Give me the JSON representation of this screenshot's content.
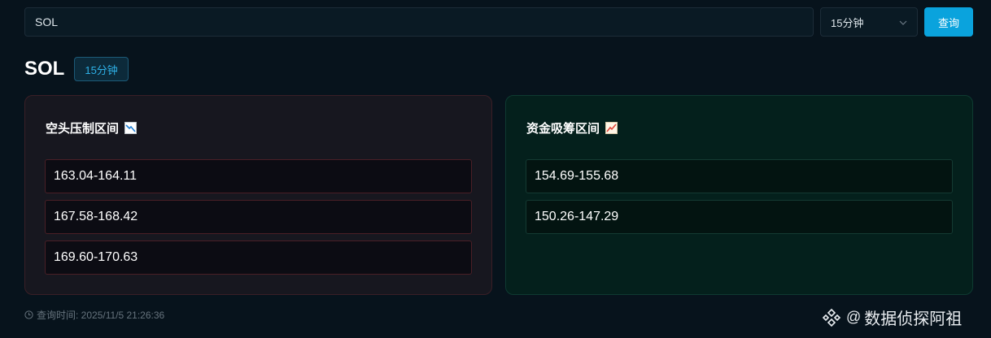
{
  "search": {
    "value": "SOL"
  },
  "interval_select": {
    "selected": "15分钟"
  },
  "query_button": {
    "label": "查询"
  },
  "title": {
    "symbol": "SOL",
    "interval_badge": "15分钟"
  },
  "bear_card": {
    "title": "空头压制区间",
    "icon": "chart-decreasing-icon",
    "zones": [
      "163.04-164.11",
      "167.58-168.42",
      "169.60-170.63"
    ]
  },
  "bull_card": {
    "title": "资金吸筹区间",
    "icon": "chart-increasing-icon",
    "zones": [
      "154.69-155.68",
      "150.26-147.29"
    ]
  },
  "footer": {
    "query_time": "查询时间: 2025/11/5 21:26:36"
  },
  "watermark": {
    "at": "@",
    "text": "数据侦探阿祖"
  },
  "colors": {
    "accent": "#0aa3dd",
    "bear_border": "#4a1f26",
    "bull_border": "#143a32",
    "background": "#07131c"
  }
}
